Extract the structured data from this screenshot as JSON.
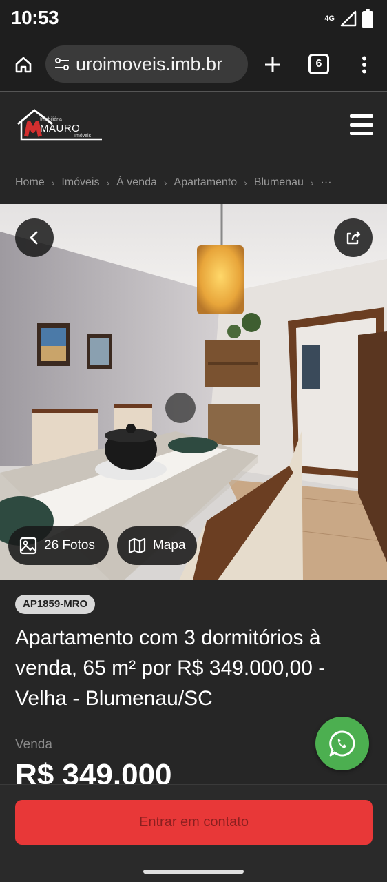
{
  "status_bar": {
    "time": "10:53",
    "network_type": "4G",
    "icons": [
      "signal-icon",
      "battery-icon"
    ]
  },
  "browser": {
    "url": "uroimoveis.imb.br",
    "tab_count": "6",
    "icons": [
      "home-icon",
      "site-settings-icon",
      "plus-icon",
      "tabs-icon",
      "more-vert-icon"
    ]
  },
  "site": {
    "logo": {
      "small_text": "Imobiliária",
      "name": "MAURO",
      "sub_text": "Imóveis",
      "accent_color": "#d32f2f"
    },
    "menu_icon": "hamburger-icon"
  },
  "breadcrumb": {
    "items": [
      "Home",
      "Imóveis",
      "À venda",
      "Apartamento",
      "Blumenau",
      "···"
    ]
  },
  "gallery": {
    "photos_label": "26 Fotos",
    "map_label": "Mapa",
    "icons": [
      "back-arrow-icon",
      "share-icon",
      "image-icon",
      "map-icon"
    ]
  },
  "listing": {
    "code": "AP1859-MRO",
    "title": "Apartamento com 3 dormitórios à venda, 65 m² por R$ 349.000,00 - Velha - Blumenau/SC",
    "price_label": "Venda",
    "price": "R$ 349.000"
  },
  "actions": {
    "contact_label": "Entrar em contato",
    "contact_color": "#e83838",
    "whatsapp_color": "#4caf50"
  }
}
